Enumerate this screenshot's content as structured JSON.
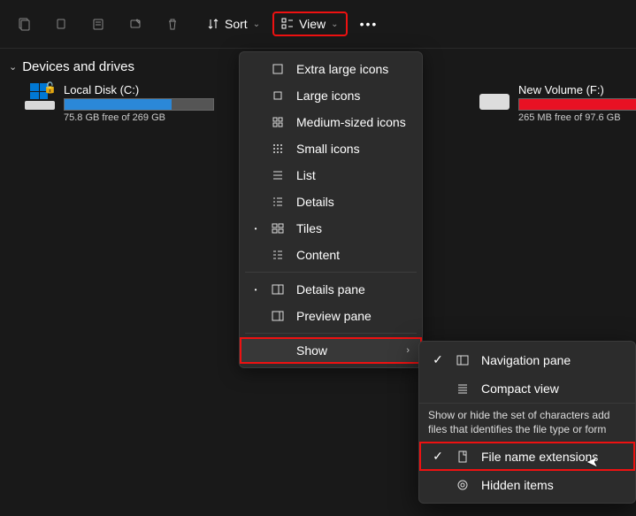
{
  "toolbar": {
    "sort_label": "Sort",
    "view_label": "View"
  },
  "section": {
    "title": "Devices and drives"
  },
  "drives": {
    "c": {
      "name": "Local Disk (C:)",
      "free": "75.8 GB free of 269 GB",
      "pct": 72
    },
    "f": {
      "name": "New Volume (F:)",
      "free": "265 MB free of 97.6 GB",
      "pct": 99
    }
  },
  "view_menu": {
    "xl": "Extra large icons",
    "lg": "Large icons",
    "md": "Medium-sized icons",
    "sm": "Small icons",
    "list": "List",
    "details": "Details",
    "tiles": "Tiles",
    "content": "Content",
    "details_pane": "Details pane",
    "preview_pane": "Preview pane",
    "show": "Show"
  },
  "show_menu": {
    "nav": "Navigation pane",
    "compact": "Compact view",
    "tip_l1": "Show or hide the set of characters add",
    "tip_l2": "files that identifies the file type or form",
    "ext": "File name extensions",
    "hidden": "Hidden items"
  }
}
